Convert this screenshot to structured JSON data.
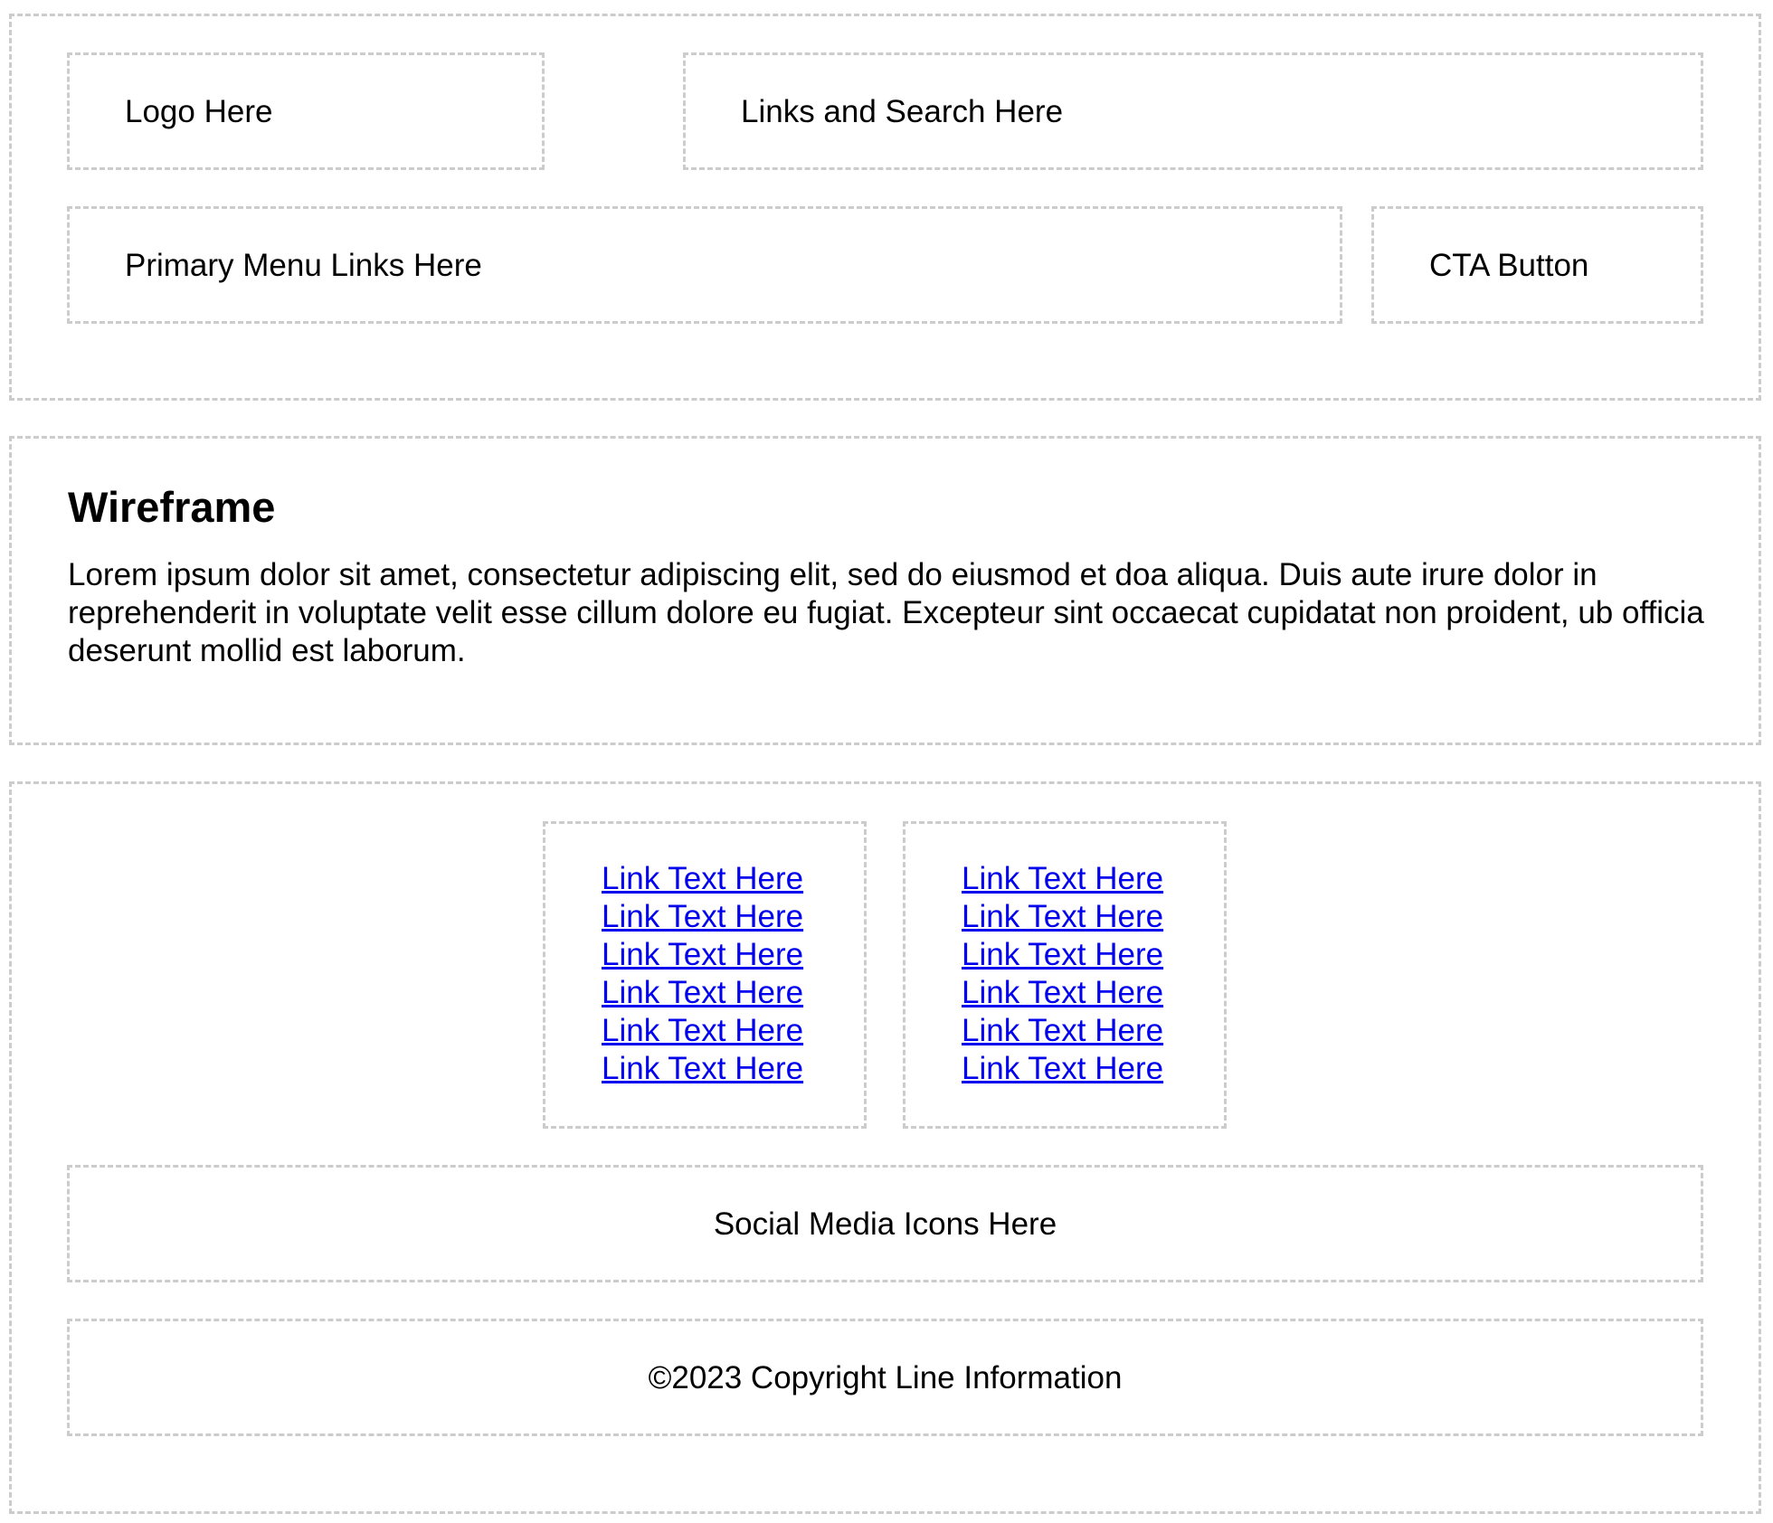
{
  "header": {
    "logo_label": "Logo Here",
    "links_search_label": "Links and Search Here",
    "primary_menu_label": "Primary Menu Links Here",
    "cta_label": "CTA Button"
  },
  "content": {
    "title": "Wireframe",
    "body": "Lorem ipsum dolor sit amet, consectetur adipiscing elit, sed do eiusmod et doa aliqua. Duis aute irure dolor in reprehenderit in voluptate velit esse cillum dolore eu fugiat. Excepteur sint occaecat cupidatat non proident, ub officia deserunt mollid est laborum."
  },
  "footer": {
    "link_columns": [
      {
        "links": [
          "Link Text Here",
          "Link Text Here",
          "Link Text Here",
          "Link Text Here",
          "Link Text Here",
          "Link Text Here"
        ]
      },
      {
        "links": [
          "Link Text Here",
          "Link Text Here",
          "Link Text Here",
          "Link Text Here",
          "Link Text Here",
          "Link Text Here"
        ]
      }
    ],
    "social_label": "Social Media Icons Here",
    "copyright": "©2023 Copyright Line Information"
  },
  "colors": {
    "border": "#cccccc",
    "link": "#0000ee",
    "text": "#000000",
    "background": "#ffffff"
  }
}
